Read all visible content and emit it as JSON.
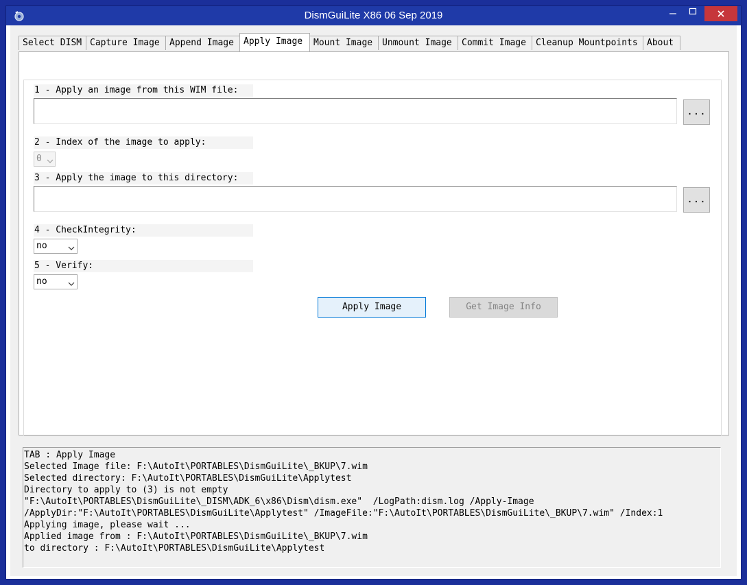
{
  "window": {
    "title": "DismGuiLite X86 06 Sep 2019"
  },
  "tabs": [
    {
      "label": "Select DISM"
    },
    {
      "label": "Capture Image"
    },
    {
      "label": "Append Image"
    },
    {
      "label": "Apply Image"
    },
    {
      "label": "Mount Image"
    },
    {
      "label": "Unmount Image"
    },
    {
      "label": "Commit Image"
    },
    {
      "label": "Cleanup Mountpoints"
    },
    {
      "label": "About"
    }
  ],
  "active_tab": "Apply Image",
  "form": {
    "wim_label": "1 - Apply an image from this WIM file:",
    "wim_value": "",
    "browse_label": "...",
    "index_label": "2 - Index of the image to apply:",
    "index_value": "0",
    "dir_label": "3 - Apply the image to this directory:",
    "dir_value": "",
    "check_label": "4 - CheckIntegrity:",
    "check_value": "no",
    "verify_label": "5 - Verify:",
    "verify_value": "no",
    "apply_button": "Apply Image",
    "info_button": "Get Image Info"
  },
  "log": [
    "TAB : Apply Image",
    "Selected Image file: F:\\AutoIt\\PORTABLES\\DismGuiLite\\_BKUP\\7.wim",
    "Selected directory: F:\\AutoIt\\PORTABLES\\DismGuiLite\\Applytest",
    "Directory to apply to (3) is not empty",
    "\"F:\\AutoIt\\PORTABLES\\DismGuiLite\\_DISM\\ADK_6\\x86\\Dism\\dism.exe\"  /LogPath:dism.log /Apply-Image",
    "/ApplyDir:\"F:\\AutoIt\\PORTABLES\\DismGuiLite\\Applytest\" /ImageFile:\"F:\\AutoIt\\PORTABLES\\DismGuiLite\\_BKUP\\7.wim\" /Index:1",
    "Applying image, please wait ...",
    "Applied image from : F:\\AutoIt\\PORTABLES\\DismGuiLite\\_BKUP\\7.wim",
    "to directory : F:\\AutoIt\\PORTABLES\\DismGuiLite\\Applytest"
  ],
  "colors": {
    "titlebar": "#1f3aa8",
    "close": "#c6363b",
    "accent": "#0078d7"
  }
}
